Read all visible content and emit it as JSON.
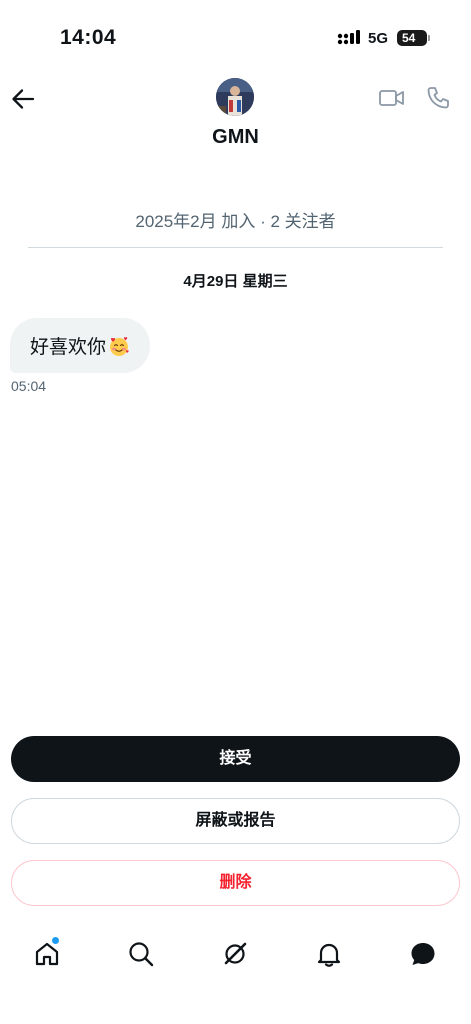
{
  "status_bar": {
    "time": "14:04",
    "network": "5G",
    "battery": "54"
  },
  "header": {
    "contact_name": "GMN",
    "icons": [
      "back-arrow-icon",
      "video-call-icon",
      "phone-call-icon"
    ]
  },
  "profile_info": {
    "join_text": "2025年2月 加入 · 2 关注者"
  },
  "conversation": {
    "date_separator": "4月29日 星期三",
    "messages": [
      {
        "text": "好喜欢你",
        "emoji": "smiling-face-with-hearts",
        "time": "05:04"
      }
    ]
  },
  "actions": {
    "accept": "接受",
    "block_report": "屏蔽或报告",
    "delete": "删除"
  },
  "tab_bar": {
    "tabs": [
      "home-icon",
      "search-icon",
      "grok-icon",
      "notifications-icon",
      "messages-icon"
    ],
    "home_has_badge": true
  },
  "colors": {
    "accent_blue": "#1d9bf0",
    "danger_red": "#f4212e",
    "primary_dark": "#0f1419",
    "secondary_text": "#536471",
    "bubble_bg": "#eff3f4"
  }
}
